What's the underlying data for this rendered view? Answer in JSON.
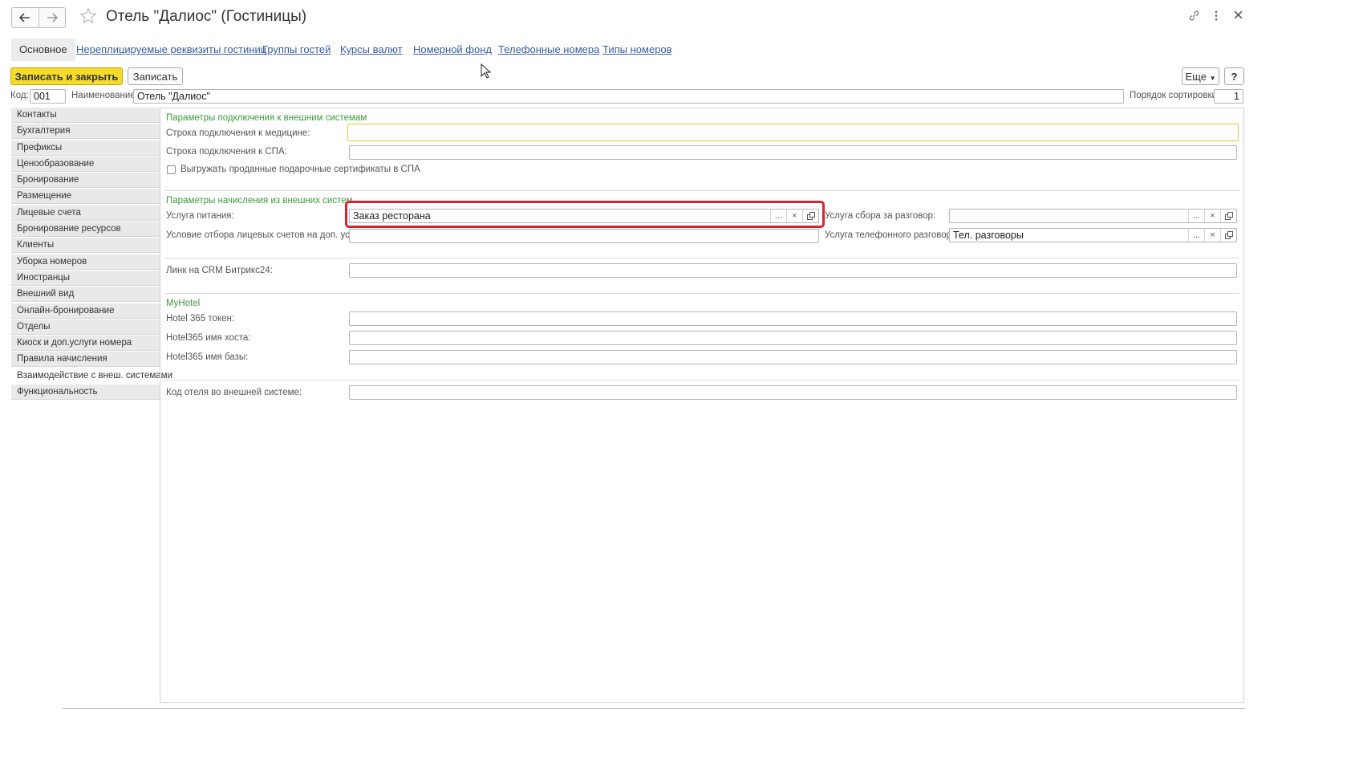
{
  "window": {
    "title": "Отель \"Далиос\" (Гостиницы)"
  },
  "nav": {
    "main_tab": "Основное",
    "links": [
      "Нереплицируемые реквизиты гостиниц",
      "Группы гостей",
      "Курсы валют",
      "Номерной фонд",
      "Телефонные номера",
      "Типы номеров"
    ]
  },
  "toolbar": {
    "save_close": "Записать и закрыть",
    "save": "Записать",
    "more": "Еще",
    "help": "?"
  },
  "header": {
    "code_label": "Код:",
    "code_value": "001",
    "name_label": "Наименование:",
    "name_value": "Отель \"Далиос\"",
    "sort_label": "Порядок сортировки:",
    "sort_value": "1"
  },
  "sidebar": {
    "items": [
      "Контакты",
      "Бухгалтерия",
      "Префиксы",
      "Ценообразование",
      "Бронирование",
      "Размещение",
      "Лицевые счета",
      "Бронирование ресурсов",
      "Клиенты",
      "Уборка номеров",
      "Иностранцы",
      "Внешний вид",
      "Онлайн-бронирование",
      "Отделы",
      "Киоск и доп.услуги номера",
      "Правила начисления",
      "Взаимодействие с внеш. системами",
      "Функциональность"
    ],
    "active_index": 16
  },
  "form": {
    "group1_title": "Параметры подключения к внешним системам",
    "medicine_label": "Строка подключения к медицине:",
    "medicine_value": "",
    "spa_label": "Строка подключения к СПА:",
    "spa_value": "",
    "export_cert_label": "Выгружать проданные подарочные сертификаты в СПА",
    "export_cert_checked": false,
    "group2_title": "Параметры начисления из внешних систем",
    "food_label": "Услуга питания:",
    "food_value": "Заказ ресторана",
    "call_fee_label": "Услуга сбора за разговор:",
    "call_fee_value": "",
    "filter_label": "Условие отбора лицевых счетов на доп. услуги:",
    "filter_value": "",
    "phone_service_label": "Услуга телефонного разговора:",
    "phone_service_value": "Тел. разговоры",
    "crm_label": "Линк на CRM Битрикс24:",
    "crm_value": "",
    "group3_title": "MyHotel",
    "token_label": "Hotel 365 токен:",
    "host_label": "Hotel365 имя хоста:",
    "db_label": "Hotel365 имя базы:",
    "ext_code_label": "Код отеля во внешней системе:"
  },
  "picker_buttons": {
    "select": "...",
    "clear": "×"
  },
  "colors": {
    "primary_button": "#f5dc2b",
    "group_title": "#3c9a3c",
    "highlight_box": "#d9232e",
    "link": "#3a5ba0"
  }
}
